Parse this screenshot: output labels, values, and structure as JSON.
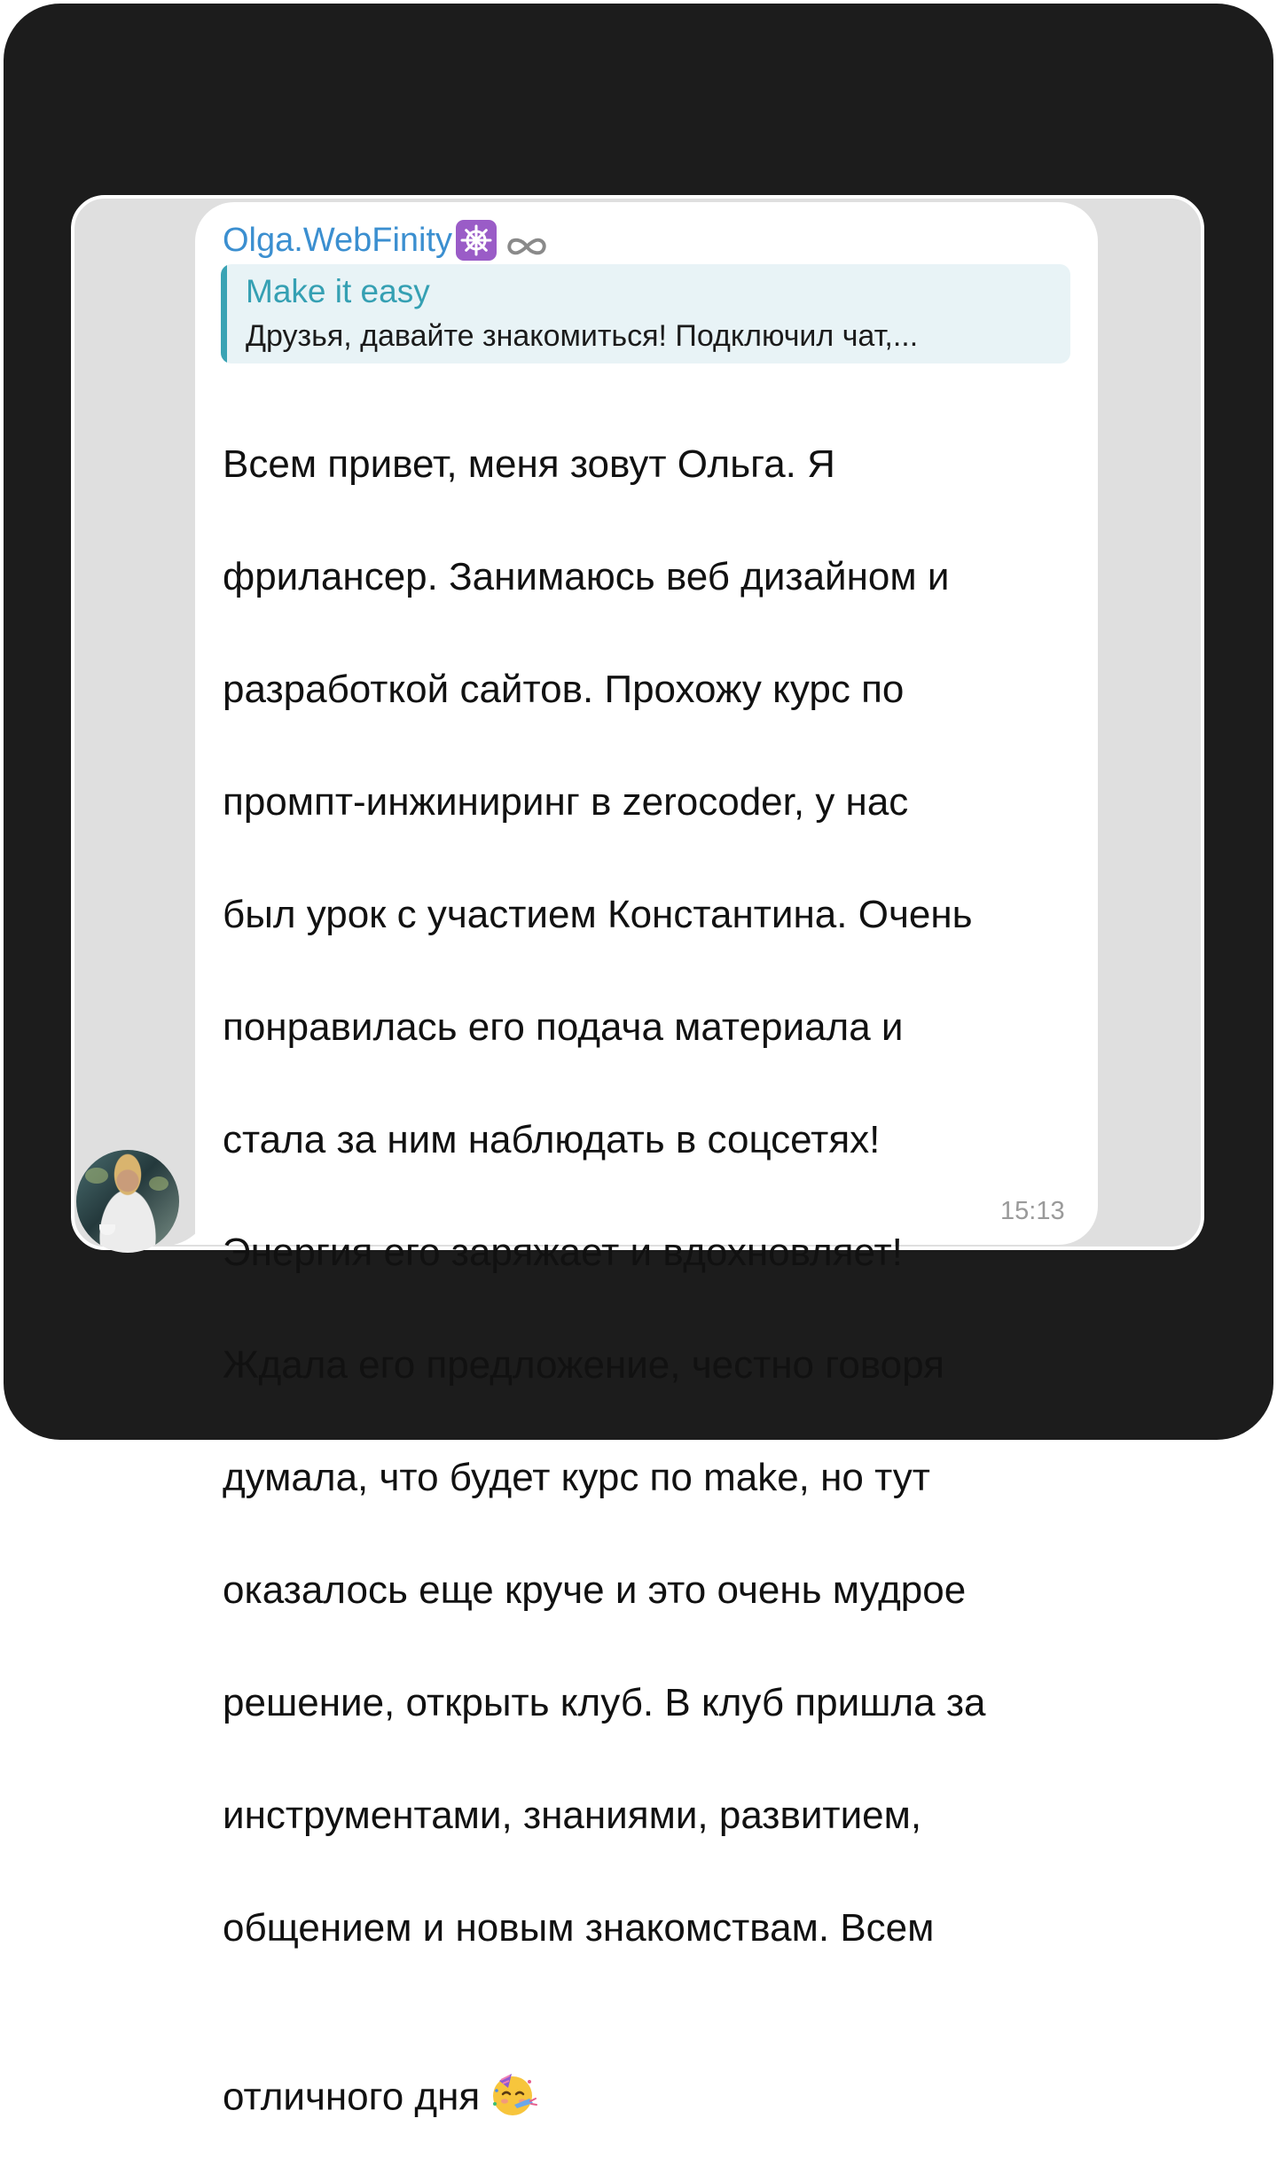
{
  "chat": {
    "sender_name": "Olga.WebFinity",
    "sender_badges": [
      "helm-badge-icon",
      "infinity-icon"
    ],
    "reply": {
      "title": "Make it easy",
      "preview": "Друзья, давайте знакомиться! Подключил чат,..."
    },
    "message_lines": [
      "Всем привет, меня зовут Ольга. Я",
      "фрилансер. Занимаюсь веб дизайном и",
      "разработкой сайтов. Прохожу курс по",
      "промпт-инжиниринг в zerocoder, у нас",
      "был урок с участием Константина. Очень",
      "понравилась его подача материала и",
      "стала за ним наблюдать в соцсетях!",
      "Энергия его заряжает и вдохновляет!",
      "Ждала его предложение, честно говоря",
      "думала, что будет курс по make, но тут",
      "оказалось еще круче и это очень мудрое",
      "решение, открыть клуб. В клуб пришла за",
      "инструментами, знаниями, развитием,",
      "общением и новым знакомствам. Всем",
      "отличного дня"
    ],
    "trailing_emoji": "partying-face-icon",
    "timestamp": "15:13"
  },
  "colors": {
    "frame": "#1c1c1c",
    "chat_background": "#dfdfdf",
    "bubble": "#ffffff",
    "sender_name": "#3b8fd0",
    "reply_accent": "#3aa3b4",
    "reply_background": "#e8f3f6",
    "timestamp": "#9a9a9a"
  }
}
